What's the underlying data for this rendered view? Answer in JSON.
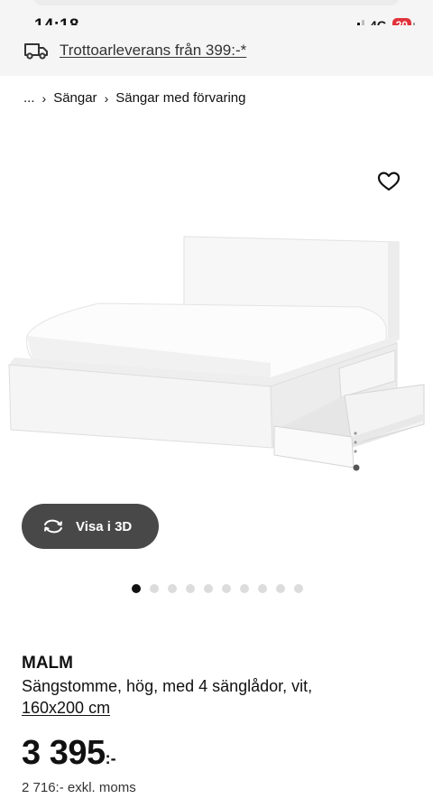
{
  "status_bar": {
    "time": "14:18",
    "network": "4G",
    "battery": "20"
  },
  "delivery_banner": {
    "text": "Trottoarleverans från 399:-*",
    "icon": "truck-icon"
  },
  "breadcrumb": {
    "items": [
      "...",
      "Sängar",
      "Sängar med förvaring"
    ]
  },
  "product": {
    "image_alt": "bed-frame-image",
    "favorite_icon": "heart-icon",
    "view_3d_label": "Visa i 3D",
    "view_3d_icon": "rotate-3d-icon",
    "carousel": {
      "total": 10,
      "active": 1
    },
    "name": "MALM",
    "description": "Sängstomme, hög, med 4 sänglådor, vit,",
    "size": "160x200 cm",
    "price": "3 395",
    "price_suffix": ":-",
    "price_excl_vat": "2 716:- exkl. moms"
  },
  "colors": {
    "banner_bg": "#f5f5f5",
    "button_bg": "#484848",
    "battery_red": "#e0333c",
    "dot_inactive": "#dcdcdc",
    "dot_active": "#111111"
  }
}
